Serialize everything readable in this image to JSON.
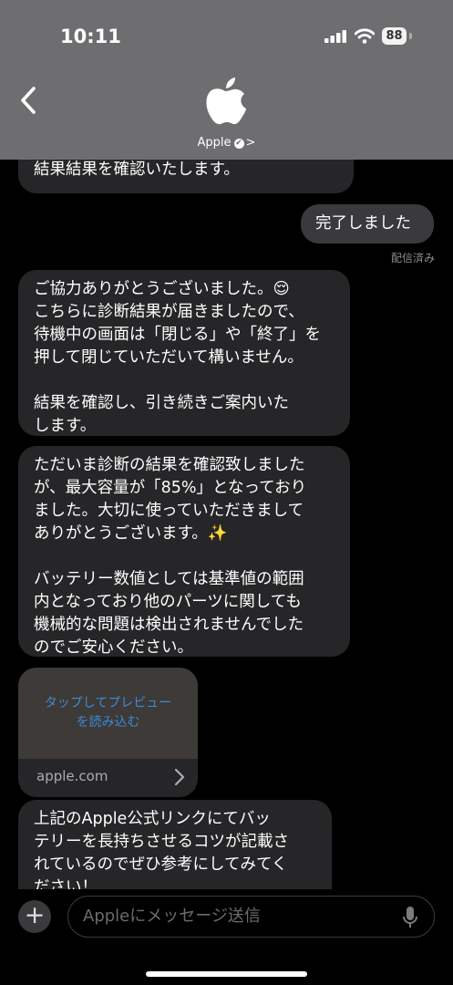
{
  "status_bar": {
    "time": "10:11",
    "battery": "88"
  },
  "header": {
    "contact_name": "Apple",
    "verified_badge": "✔",
    "chevron": ">"
  },
  "messages": [
    {
      "direction": "incoming",
      "text": "結果結果を確認いたします。"
    },
    {
      "direction": "outgoing",
      "text": "完了しました",
      "status": "配信済み"
    },
    {
      "direction": "incoming",
      "text": "ご協力ありがとうございました。😌\nこちらに診断結果が届きましたので、\n待機中の画面は「閉じる」や「終了」を\n押して閉じていただいて構いません。\n\n結果を確認し、引き続きご案内いた\nします。"
    },
    {
      "direction": "incoming",
      "text": "ただいま診断の結果を確認致しました\nが、最大容量が「85%」となっており\nました。大切に使っていただきまして\nありがとうございます。✨\n\nバッテリー数値としては基準値の範囲\n内となっており他のパーツに関しても\n機械的な問題は検出されませんでした\nのでご安心ください。"
    },
    {
      "direction": "incoming",
      "type": "link",
      "preview_text": "タップしてプレビュー\nを読み込む",
      "domain": "apple.com"
    },
    {
      "direction": "incoming",
      "text": "上記のApple公式リンクにてバッ\nテリーを長持ちさせるコツが記載さ\nれているのでぜひ参考にしてみてく\nださい！"
    }
  ],
  "composer": {
    "placeholder": "Appleにメッセージ送信",
    "plus_label": "+"
  },
  "icons": {
    "back": "chevron-left-icon",
    "logo": "apple-logo-icon",
    "mic": "microphone-icon",
    "signal": "cellular-signal-icon",
    "wifi": "wifi-icon"
  },
  "colors": {
    "header_bg": "#6e6e70",
    "incoming_bubble": "#262628",
    "outgoing_bubble": "#3a3a3c",
    "link_blue": "#3d8bd8"
  }
}
